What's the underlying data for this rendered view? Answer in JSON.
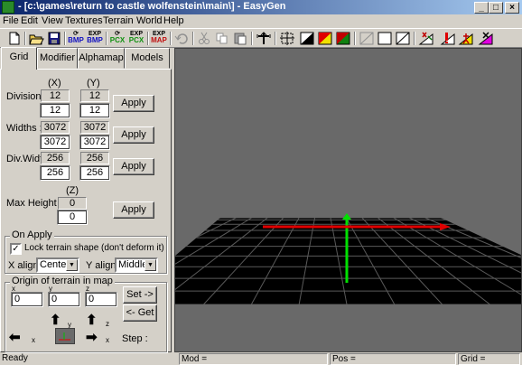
{
  "window": {
    "title": "- [c:\\games\\return to castle wolfenstein\\main\\] - EasyGen",
    "minimize": "_",
    "maximize": "□",
    "close": "×"
  },
  "menu": [
    "File",
    "Edit",
    "View",
    "Textures",
    "Terrain",
    "World",
    "Help"
  ],
  "toolbar": {
    "bmp_import_top": "⟳",
    "bmp_import": "BMP",
    "bmp_export_top": "EXP",
    "bmp_export": "BMP",
    "pcx_import_top": "⟳",
    "pcx_import": "PCX",
    "pcx_export_top": "EXP",
    "pcx_export": "PCX",
    "map_export_top": "EXP",
    "map_export": "MAP"
  },
  "tabs": [
    "Grid",
    "Modifier",
    "Alphamap",
    "Models"
  ],
  "active_tab": "Grid",
  "grid": {
    "col_x": "(X)",
    "col_y": "(Y)",
    "col_z": "(Z)",
    "divisions_label": "Divisions :",
    "divisions_x_current": "12",
    "divisions_y_current": "12",
    "divisions_x": "12",
    "divisions_y": "12",
    "widths_label": "Widths :",
    "widths_x_current": "3072",
    "widths_y_current": "3072",
    "widths_x": "3072",
    "widths_y": "3072",
    "divwidt_label": "Div.Widt. :",
    "divwidt_x_current": "256",
    "divwidt_y_current": "256",
    "divwidt_x": "256",
    "divwidt_y": "256",
    "maxheight_label": "Max Height :",
    "maxheight_current": "0",
    "maxheight": "0",
    "apply": "Apply"
  },
  "on_apply": {
    "title": "On Apply",
    "lock_label": "Lock terrain shape (don't deform it)",
    "lock_checked": "✓",
    "xalign_label": "X align",
    "xalign_value": "Center",
    "yalign_label": "Y align",
    "yalign_value": "Middle"
  },
  "origin": {
    "title": "Origin of terrain in map",
    "x_label": "x",
    "y_label": "y",
    "z_label": "z",
    "x_value": "0",
    "y_value": "0",
    "z_value": "0",
    "set_button": "Set ->",
    "get_button": "<- Get",
    "step_label": "Step :",
    "arrow_y_label": "y",
    "arrow_z_label": "z",
    "arrow_x_left_label": "x",
    "arrow_x_right_label": "x"
  },
  "status": {
    "ready": "Ready",
    "mod": "Mod =",
    "pos": "Pos =",
    "grid": "Grid ="
  },
  "colors": {
    "viewport_bg": "#696969",
    "terrain_axis_x": "#e00000",
    "terrain_axis_y": "#00e000",
    "titlebar_start": "#0a246a"
  }
}
